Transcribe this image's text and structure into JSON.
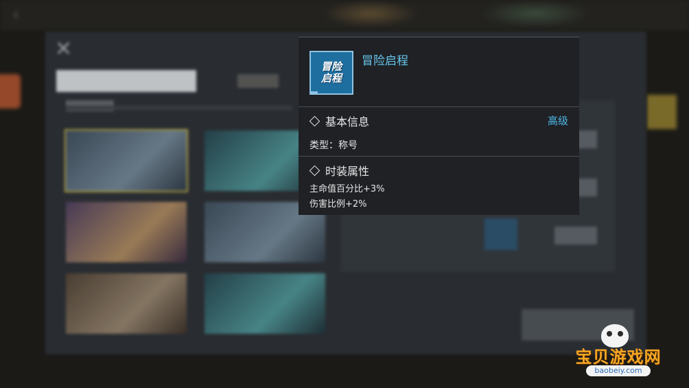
{
  "item": {
    "name": "冒险启程",
    "icon_text": "冒险启程",
    "icon_name": "title-badge-icon"
  },
  "basic_info": {
    "title": "基本信息",
    "level": "高级",
    "type_line": "类型：称号"
  },
  "costume_attr": {
    "title": "时装属性",
    "lines": [
      "主命值百分比+3%",
      "伤害比例+2%"
    ]
  },
  "watermark": {
    "text": "宝贝游戏网",
    "url": "baobeiy.com"
  },
  "colors": {
    "accent_cyan": "#67c6ec",
    "level_blue": "#4fb8e8",
    "tooltip_bg": "#1f2125"
  }
}
